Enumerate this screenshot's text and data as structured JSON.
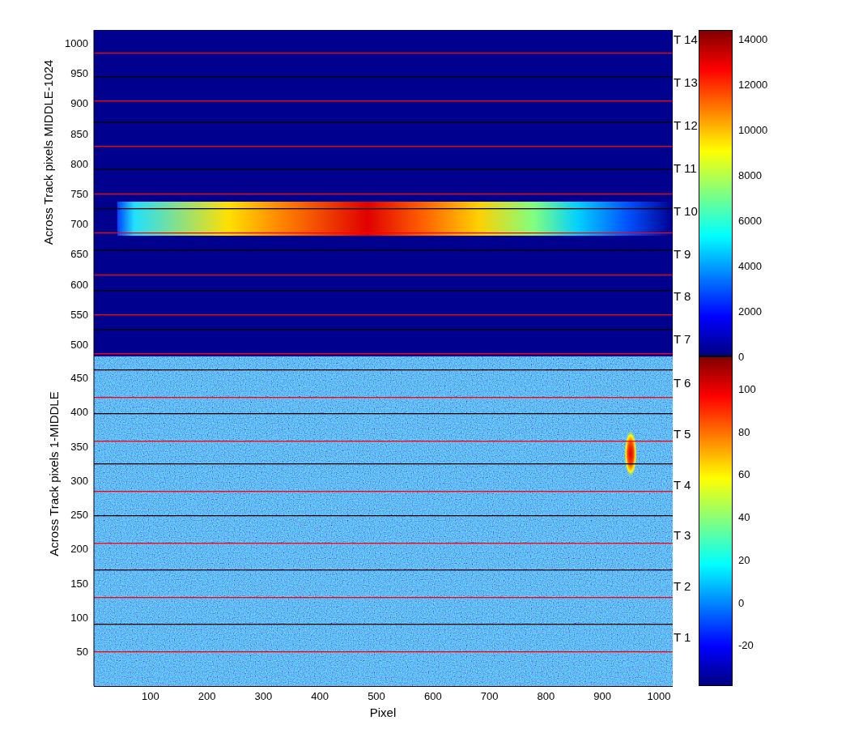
{
  "figure": {
    "panels": [
      {
        "ylabel": "Across Track pixels MIDDLE-1024",
        "yticks": [
          "1000",
          "950",
          "900",
          "850",
          "800",
          "750",
          "700",
          "650",
          "600",
          "550",
          "500"
        ],
        "track_labels": [
          "T 14",
          "T 13",
          "T 12",
          "T 11",
          "T 10",
          "T 9",
          "T 8",
          "T 7"
        ],
        "colorbar_ticks": [
          "14000",
          "12000",
          "10000",
          "8000",
          "6000",
          "4000",
          "2000",
          "0"
        ]
      },
      {
        "ylabel": "Across Track pixels 1-MIDDLE",
        "yticks": [
          "450",
          "400",
          "350",
          "300",
          "250",
          "200",
          "150",
          "100",
          "50"
        ],
        "track_labels": [
          "T 6",
          "T 5",
          "T 4",
          "T 3",
          "T 2",
          "T 1"
        ],
        "colorbar_ticks": [
          "100",
          "80",
          "60",
          "40",
          "20",
          "0",
          "-20"
        ]
      }
    ],
    "xticks": [
      "100",
      "200",
      "300",
      "400",
      "500",
      "600",
      "700",
      "800",
      "900",
      "1000"
    ],
    "xlabel": "Pixel"
  }
}
